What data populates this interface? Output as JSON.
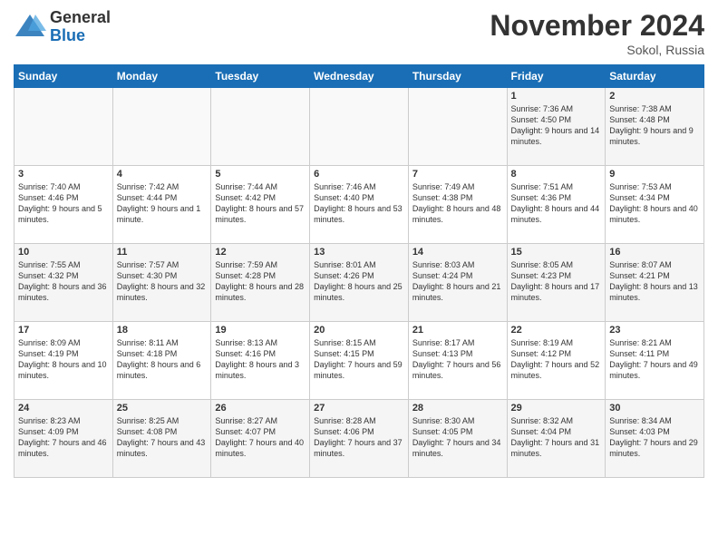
{
  "logo": {
    "general": "General",
    "blue": "Blue"
  },
  "header": {
    "month": "November 2024",
    "location": "Sokol, Russia"
  },
  "weekdays": [
    "Sunday",
    "Monday",
    "Tuesday",
    "Wednesday",
    "Thursday",
    "Friday",
    "Saturday"
  ],
  "weeks": [
    [
      {
        "day": "",
        "info": ""
      },
      {
        "day": "",
        "info": ""
      },
      {
        "day": "",
        "info": ""
      },
      {
        "day": "",
        "info": ""
      },
      {
        "day": "",
        "info": ""
      },
      {
        "day": "1",
        "info": "Sunrise: 7:36 AM\nSunset: 4:50 PM\nDaylight: 9 hours and 14 minutes."
      },
      {
        "day": "2",
        "info": "Sunrise: 7:38 AM\nSunset: 4:48 PM\nDaylight: 9 hours and 9 minutes."
      }
    ],
    [
      {
        "day": "3",
        "info": "Sunrise: 7:40 AM\nSunset: 4:46 PM\nDaylight: 9 hours and 5 minutes."
      },
      {
        "day": "4",
        "info": "Sunrise: 7:42 AM\nSunset: 4:44 PM\nDaylight: 9 hours and 1 minute."
      },
      {
        "day": "5",
        "info": "Sunrise: 7:44 AM\nSunset: 4:42 PM\nDaylight: 8 hours and 57 minutes."
      },
      {
        "day": "6",
        "info": "Sunrise: 7:46 AM\nSunset: 4:40 PM\nDaylight: 8 hours and 53 minutes."
      },
      {
        "day": "7",
        "info": "Sunrise: 7:49 AM\nSunset: 4:38 PM\nDaylight: 8 hours and 48 minutes."
      },
      {
        "day": "8",
        "info": "Sunrise: 7:51 AM\nSunset: 4:36 PM\nDaylight: 8 hours and 44 minutes."
      },
      {
        "day": "9",
        "info": "Sunrise: 7:53 AM\nSunset: 4:34 PM\nDaylight: 8 hours and 40 minutes."
      }
    ],
    [
      {
        "day": "10",
        "info": "Sunrise: 7:55 AM\nSunset: 4:32 PM\nDaylight: 8 hours and 36 minutes."
      },
      {
        "day": "11",
        "info": "Sunrise: 7:57 AM\nSunset: 4:30 PM\nDaylight: 8 hours and 32 minutes."
      },
      {
        "day": "12",
        "info": "Sunrise: 7:59 AM\nSunset: 4:28 PM\nDaylight: 8 hours and 28 minutes."
      },
      {
        "day": "13",
        "info": "Sunrise: 8:01 AM\nSunset: 4:26 PM\nDaylight: 8 hours and 25 minutes."
      },
      {
        "day": "14",
        "info": "Sunrise: 8:03 AM\nSunset: 4:24 PM\nDaylight: 8 hours and 21 minutes."
      },
      {
        "day": "15",
        "info": "Sunrise: 8:05 AM\nSunset: 4:23 PM\nDaylight: 8 hours and 17 minutes."
      },
      {
        "day": "16",
        "info": "Sunrise: 8:07 AM\nSunset: 4:21 PM\nDaylight: 8 hours and 13 minutes."
      }
    ],
    [
      {
        "day": "17",
        "info": "Sunrise: 8:09 AM\nSunset: 4:19 PM\nDaylight: 8 hours and 10 minutes."
      },
      {
        "day": "18",
        "info": "Sunrise: 8:11 AM\nSunset: 4:18 PM\nDaylight: 8 hours and 6 minutes."
      },
      {
        "day": "19",
        "info": "Sunrise: 8:13 AM\nSunset: 4:16 PM\nDaylight: 8 hours and 3 minutes."
      },
      {
        "day": "20",
        "info": "Sunrise: 8:15 AM\nSunset: 4:15 PM\nDaylight: 7 hours and 59 minutes."
      },
      {
        "day": "21",
        "info": "Sunrise: 8:17 AM\nSunset: 4:13 PM\nDaylight: 7 hours and 56 minutes."
      },
      {
        "day": "22",
        "info": "Sunrise: 8:19 AM\nSunset: 4:12 PM\nDaylight: 7 hours and 52 minutes."
      },
      {
        "day": "23",
        "info": "Sunrise: 8:21 AM\nSunset: 4:11 PM\nDaylight: 7 hours and 49 minutes."
      }
    ],
    [
      {
        "day": "24",
        "info": "Sunrise: 8:23 AM\nSunset: 4:09 PM\nDaylight: 7 hours and 46 minutes."
      },
      {
        "day": "25",
        "info": "Sunrise: 8:25 AM\nSunset: 4:08 PM\nDaylight: 7 hours and 43 minutes."
      },
      {
        "day": "26",
        "info": "Sunrise: 8:27 AM\nSunset: 4:07 PM\nDaylight: 7 hours and 40 minutes."
      },
      {
        "day": "27",
        "info": "Sunrise: 8:28 AM\nSunset: 4:06 PM\nDaylight: 7 hours and 37 minutes."
      },
      {
        "day": "28",
        "info": "Sunrise: 8:30 AM\nSunset: 4:05 PM\nDaylight: 7 hours and 34 minutes."
      },
      {
        "day": "29",
        "info": "Sunrise: 8:32 AM\nSunset: 4:04 PM\nDaylight: 7 hours and 31 minutes."
      },
      {
        "day": "30",
        "info": "Sunrise: 8:34 AM\nSunset: 4:03 PM\nDaylight: 7 hours and 29 minutes."
      }
    ]
  ]
}
